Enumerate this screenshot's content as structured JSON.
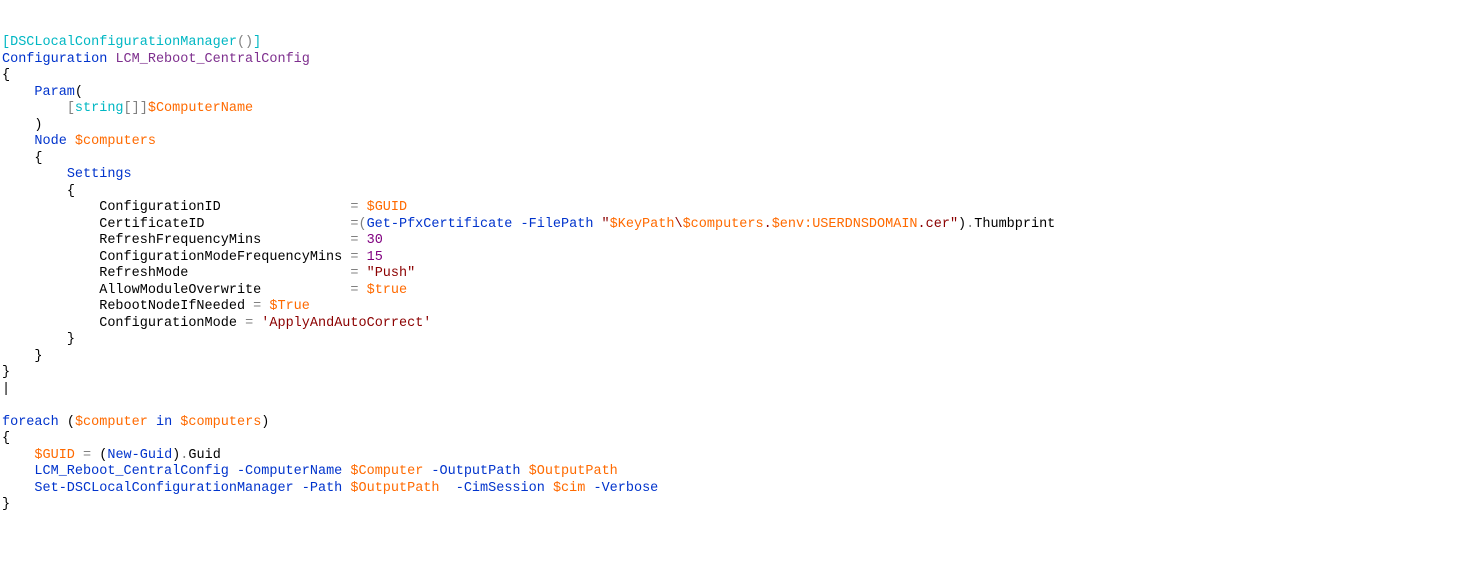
{
  "code": {
    "attr_open": "[",
    "attr_name": "DSCLocalConfigurationManager",
    "attr_parens": "()",
    "attr_close": "]",
    "kw_configuration": "Configuration",
    "config_name": "LCM_Reboot_CentralConfig",
    "brace_open": "{",
    "brace_close": "}",
    "kw_param": "Param",
    "paren_open": "(",
    "paren_close": ")",
    "bracket_open": "[",
    "bracket_close": "]",
    "type_string": "string",
    "array_brackets": "[]",
    "var_computername": "$ComputerName",
    "kw_node": "Node",
    "var_computers": "$computers",
    "kw_settings": "Settings",
    "prop_configurationid": "ConfigurationID",
    "eq": "=",
    "var_guid": "$GUID",
    "prop_certificateid": "CertificateID",
    "eq_paren": "=(",
    "cmd_getpfx": "Get-PfxCertificate",
    "param_filepath": "-FilePath",
    "str_certpath_open": "\"",
    "var_keypath": "$KeyPath",
    "str_backslash": "\\",
    "str_dot": ".",
    "var_env": "$env:USERDNSDOMAIN",
    "str_cer": ".cer",
    "str_certpath_close": "\"",
    "paren_close2": ")",
    "dot": ".",
    "prop_thumbprint": "Thumbprint",
    "prop_refreshfreq": "RefreshFrequencyMins",
    "num_30": "30",
    "prop_configmodefreq": "ConfigurationModeFrequencyMins",
    "num_15": "15",
    "prop_refreshmode": "RefreshMode",
    "str_push": "\"Push\"",
    "prop_allowoverwrite": "AllowModuleOverwrite",
    "var_true": "$true",
    "prop_rebootneeded": "RebootNodeIfNeeded",
    "var_True": "$True",
    "prop_configmode": "ConfigurationMode",
    "str_applyauto": "'ApplyAndAutoCorrect'",
    "cursor": "|",
    "kw_foreach": "foreach",
    "var_computer": "$computer",
    "kw_in": "in",
    "cmd_newguid": "New-Guid",
    "prop_guid": "Guid",
    "cmd_lcm": "LCM_Reboot_CentralConfig",
    "param_computername": "-ComputerName",
    "var_Computer": "$Computer",
    "param_outputpath": "-OutputPath",
    "var_outputpath": "$OutputPath",
    "cmd_setdsc": "Set-DSCLocalConfigurationManager",
    "param_path": "-Path",
    "param_cimsession": "-CimSession",
    "var_cim": "$cim",
    "param_verbose": "-Verbose"
  }
}
